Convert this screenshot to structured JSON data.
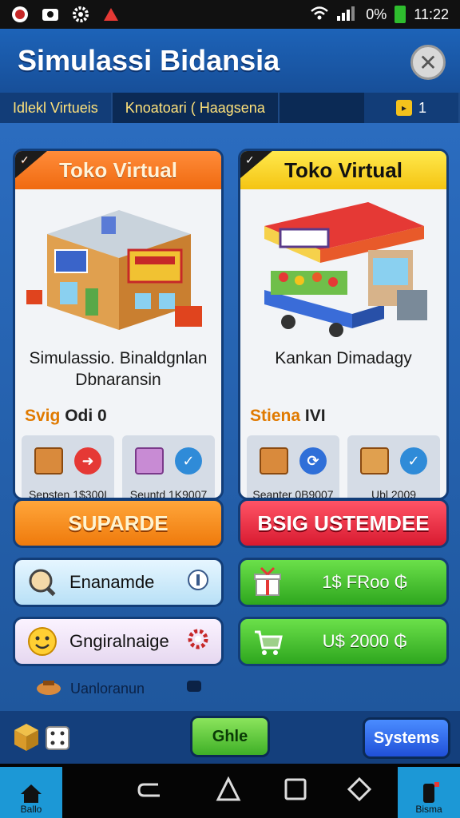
{
  "statusbar": {
    "battery_text": "0%",
    "time": "11:22"
  },
  "header": {
    "title": "Simulassi Bidansia",
    "close_icon": "close-icon"
  },
  "tabs": [
    {
      "label": "Idlekl Virtueis"
    },
    {
      "label": "Knoatoari ( Haagsena"
    }
  ],
  "counter": {
    "value": "1"
  },
  "cards": [
    {
      "title": "Toko Virtual",
      "description_line1": "Simulassio. Binaldgnlan",
      "description_line2": "Dbnaransin",
      "stat_prefix": "Svig",
      "stat_value": "Odi 0",
      "mini": [
        {
          "label": "Sepsten 1$300I"
        },
        {
          "label": "Seuntd  1K9007"
        }
      ],
      "button": "SUPARDE"
    },
    {
      "title": "Toko Virtual",
      "description_line1": "Kankan Dimadagy",
      "description_line2": "",
      "stat_prefix": "Stiena",
      "stat_value": "IVI",
      "mini": [
        {
          "label": "Seanter 0B9007"
        },
        {
          "label": "Ubl      2009"
        }
      ],
      "button": "BSIG USTEMDEE"
    }
  ],
  "options": {
    "blue": "Enanamde",
    "purple": "Gngiralnaige",
    "green1": "1$ FRoo ₲",
    "green2": "U$ 2000 ₲"
  },
  "footer_note": "Uanloranun",
  "actions": {
    "center": "Ghle",
    "right": "Systems"
  },
  "nav": {
    "home": "Ballo",
    "right": "Bisma"
  },
  "colors": {
    "header": "#1d63b8",
    "panel": "#2b6cbf",
    "orange": "#ef7a0c",
    "red": "#d81a30",
    "green": "#2ea61e",
    "blue_btn": "#2050d8"
  }
}
